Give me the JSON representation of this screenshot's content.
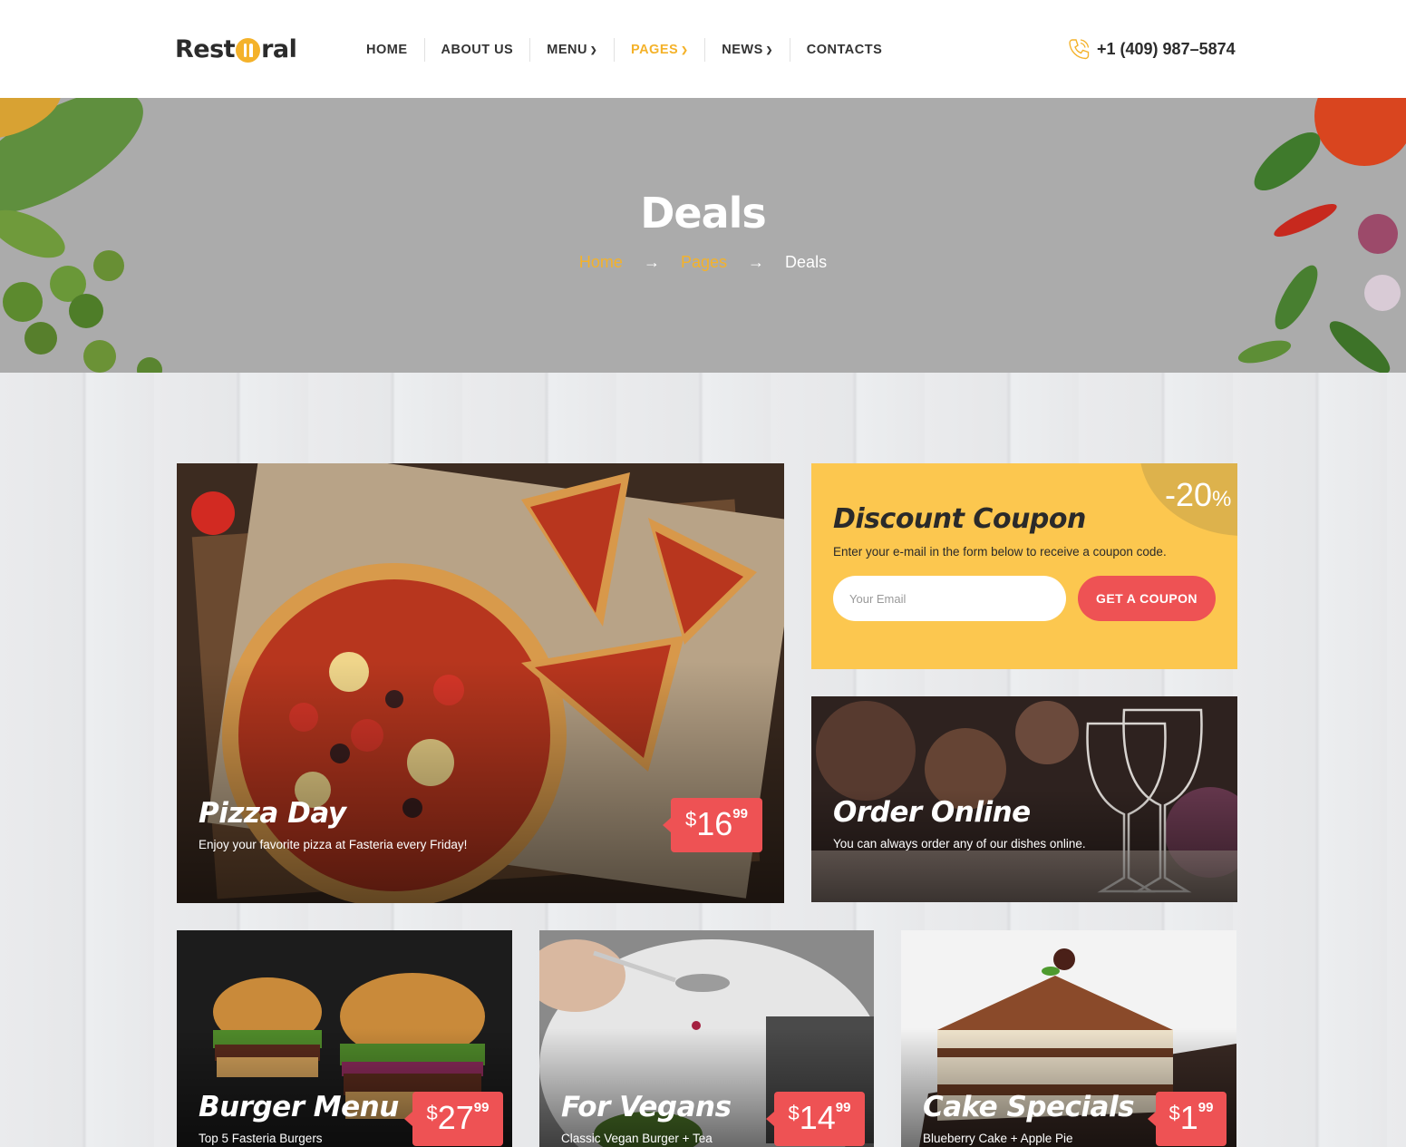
{
  "brand": {
    "logo_left": "Rest",
    "logo_right": "ral"
  },
  "nav": {
    "items": [
      {
        "label": "HOME",
        "dropdown": false,
        "active": false
      },
      {
        "label": "ABOUT US",
        "dropdown": false,
        "active": false
      },
      {
        "label": "MENU",
        "dropdown": true,
        "active": false
      },
      {
        "label": "PAGES",
        "dropdown": true,
        "active": true
      },
      {
        "label": "NEWS",
        "dropdown": true,
        "active": false
      },
      {
        "label": "CONTACTS",
        "dropdown": false,
        "active": false
      }
    ]
  },
  "contact": {
    "phone": "+1 (409) 987–5874"
  },
  "hero": {
    "title": "Deals",
    "breadcrumb": {
      "home": "Home",
      "pages": "Pages",
      "current": "Deals",
      "separator": "→"
    }
  },
  "coupon": {
    "discount": "-20",
    "percent_sign": "%",
    "title": "Discount Coupon",
    "description": "Enter your e-mail in the form below to receive a coupon code.",
    "email_placeholder": "Your Email",
    "button_label": "GET A COUPON"
  },
  "deals": {
    "pizza": {
      "title": "Pizza Day",
      "subtitle": "Enjoy your favorite pizza at Fasteria every Friday!",
      "currency": "$",
      "price_main": "16",
      "price_cents": "99"
    },
    "order": {
      "title": "Order Online",
      "subtitle": "You can always order any of our dishes online."
    },
    "burger": {
      "title": "Burger Menu",
      "subtitle": "Top 5 Fasteria Burgers",
      "currency": "$",
      "price_main": "27",
      "price_cents": "99"
    },
    "vegans": {
      "title": "For Vegans",
      "subtitle": "Classic Vegan Burger + Tea",
      "currency": "$",
      "price_main": "14",
      "price_cents": "99"
    },
    "cake": {
      "title": "Cake Specials",
      "subtitle": "Blueberry Cake + Apple Pie",
      "currency": "$",
      "price_main": "1",
      "price_cents": "99"
    }
  },
  "colors": {
    "accent": "#f4b22a",
    "price_bg": "#ee5254",
    "coupon_bg": "#fcc74f",
    "hero_bg": "#ababab"
  }
}
